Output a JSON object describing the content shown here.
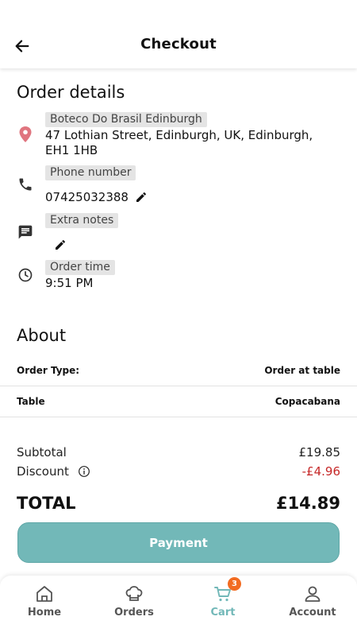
{
  "header": {
    "title": "Checkout",
    "back_icon": "arrow-left-icon"
  },
  "order_details": {
    "title": "Order details",
    "restaurant": {
      "icon": "location-pin-icon",
      "name": "Boteco Do Brasil Edinburgh",
      "address_line1": "47 Lothian Street, Edinburgh, UK, Edinburgh,",
      "address_line2": "EH1 1HB"
    },
    "phone": {
      "icon": "phone-icon",
      "label": "Phone number",
      "value": "07425032388",
      "edit_icon": "pencil-icon"
    },
    "notes": {
      "icon": "message-icon",
      "label": "Extra notes",
      "value": "",
      "edit_icon": "pencil-icon"
    },
    "time": {
      "icon": "clock-icon",
      "label": "Order time",
      "value": "9:51 PM"
    },
    "pin_color": "#e0757f"
  },
  "about": {
    "title": "About",
    "rows": [
      {
        "key": "Order Type:",
        "value": "Order at table"
      },
      {
        "key": "Table",
        "value": "Copacabana"
      }
    ]
  },
  "summary": {
    "subtotal_label": "Subtotal",
    "subtotal_value": "£19.85",
    "discount_label": "Discount",
    "discount_value": "-£4.96",
    "total_label": "TOTAL",
    "total_value": "£14.89",
    "discount_color": "#c62828"
  },
  "payment_button": {
    "label": "Payment",
    "color": "#72b8b8"
  },
  "nav": {
    "items": [
      {
        "label": "Home",
        "icon": "home-icon"
      },
      {
        "label": "Orders",
        "icon": "chef-hat-icon"
      },
      {
        "label": "Cart",
        "icon": "cart-icon",
        "badge": "3",
        "active": true
      },
      {
        "label": "Account",
        "icon": "user-icon"
      }
    ],
    "active_color": "#72b8b8",
    "badge_color": "#f26b21"
  }
}
